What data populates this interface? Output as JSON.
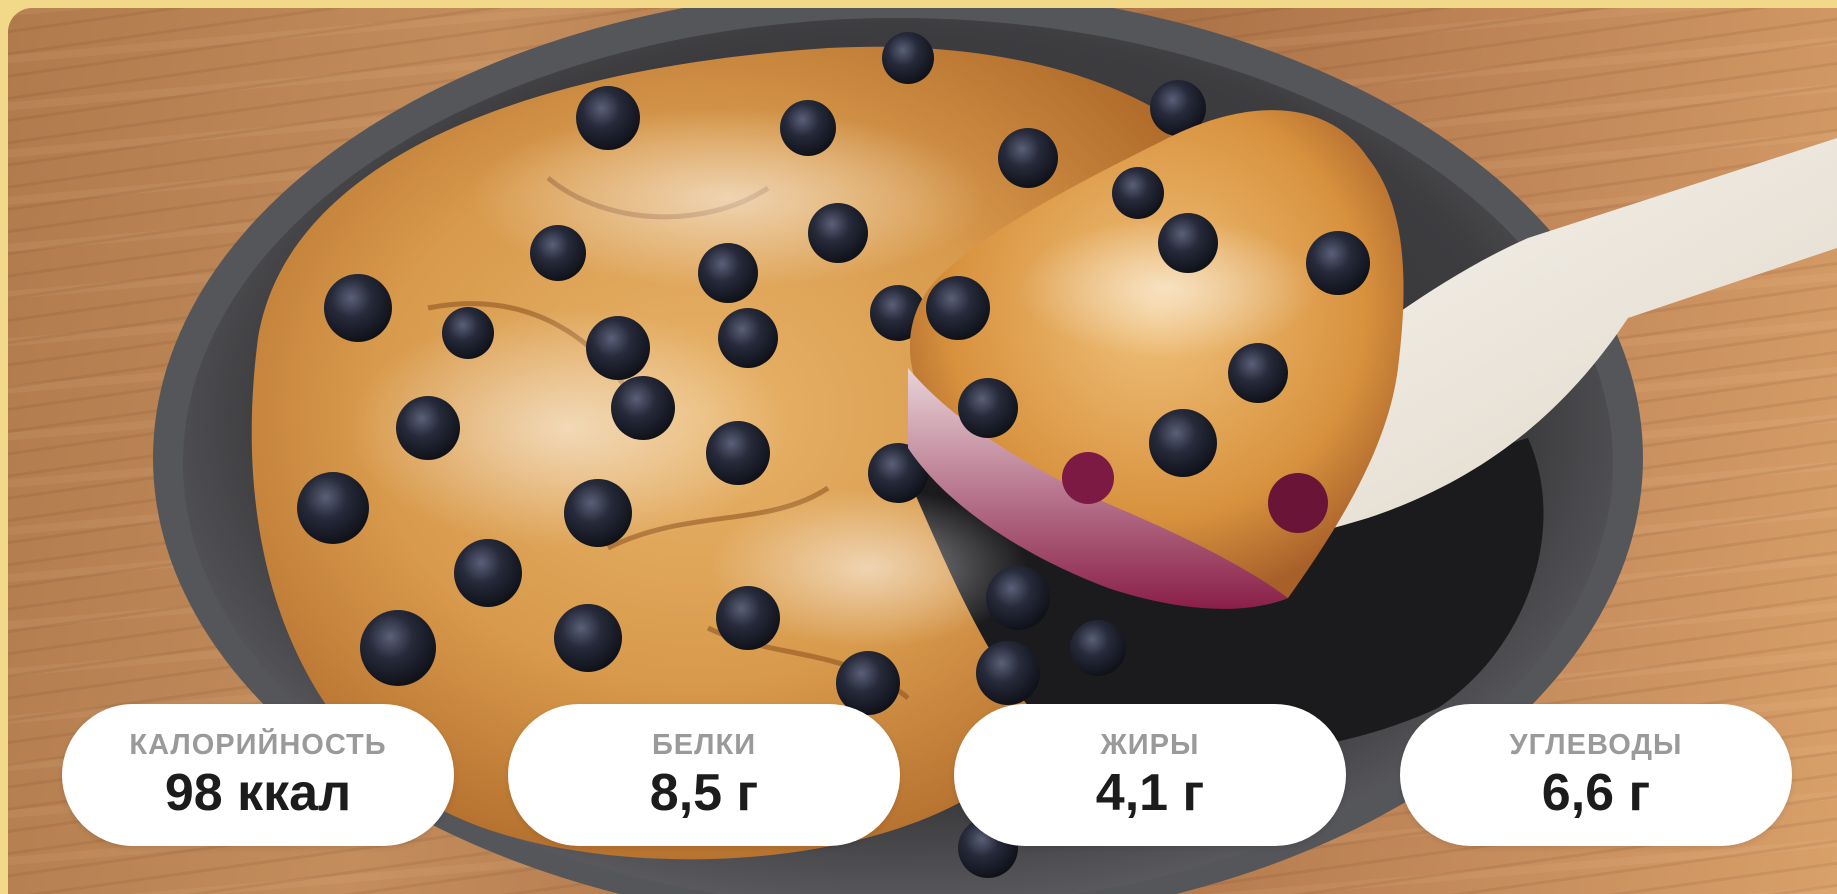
{
  "image": {
    "subject": "blueberry-cake-photo",
    "colors": {
      "background_frame": "#f2d98a",
      "wood_table": "#b07a4c",
      "pan": "#3a3a3c",
      "cake_crust": "#d89a4c",
      "blueberry": "#1f2233",
      "spatula": "#f1ece4",
      "pill_background": "#ffffff",
      "label_gray": "#9a9a9a",
      "value_dark": "#1c1c1c"
    }
  },
  "nutrition": [
    {
      "label": "КАЛОРИЙНОСТЬ",
      "value": "98 ккал"
    },
    {
      "label": "БЕЛКИ",
      "value": "8,5 г"
    },
    {
      "label": "ЖИРЫ",
      "value": "4,1 г"
    },
    {
      "label": "УГЛЕВОДЫ",
      "value": "6,6 г"
    }
  ]
}
